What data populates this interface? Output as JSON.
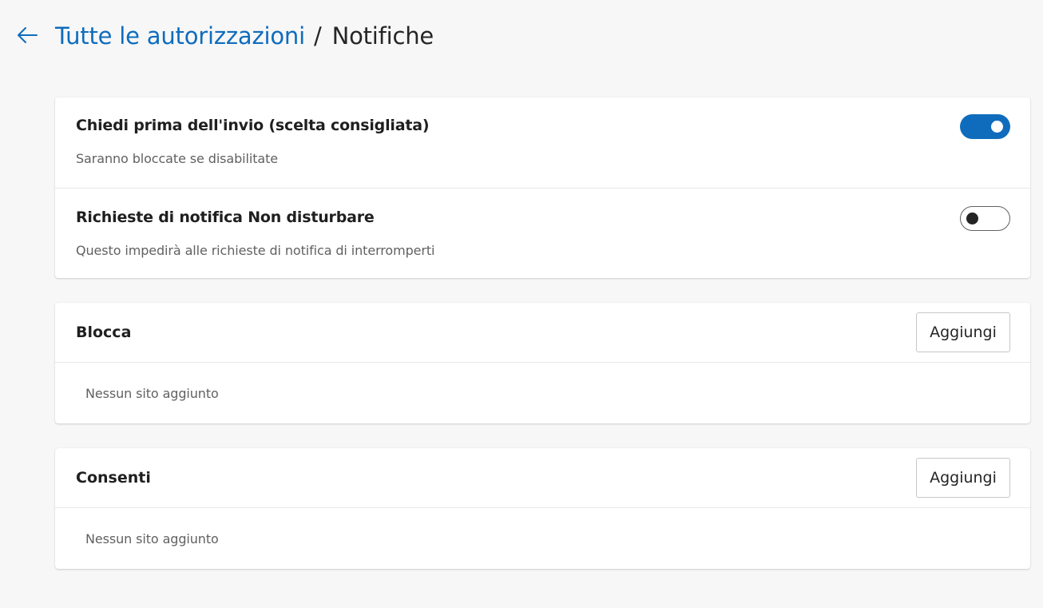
{
  "header": {
    "back_icon": "arrow-left-icon",
    "breadcrumb_parent": "Tutte le autorizzazioni",
    "breadcrumb_separator": "/",
    "breadcrumb_current": "Notifiche"
  },
  "settings": {
    "items": [
      {
        "title": "Chiedi prima dell'invio (scelta consigliata)",
        "description": "Saranno bloccate se disabilitate",
        "enabled": true
      },
      {
        "title": "Richieste di notifica Non disturbare",
        "description": "Questo impedirà alle richieste di notifica di interromperti",
        "enabled": false
      }
    ]
  },
  "block": {
    "title": "Blocca",
    "add_label": "Aggiungi",
    "empty_text": "Nessun sito aggiunto"
  },
  "allow": {
    "title": "Consenti",
    "add_label": "Aggiungi",
    "empty_text": "Nessun sito aggiunto"
  },
  "colors": {
    "accent": "#0f6cbd",
    "background": "#f7f7f7",
    "card": "#ffffff",
    "secondary_text": "#616161"
  }
}
